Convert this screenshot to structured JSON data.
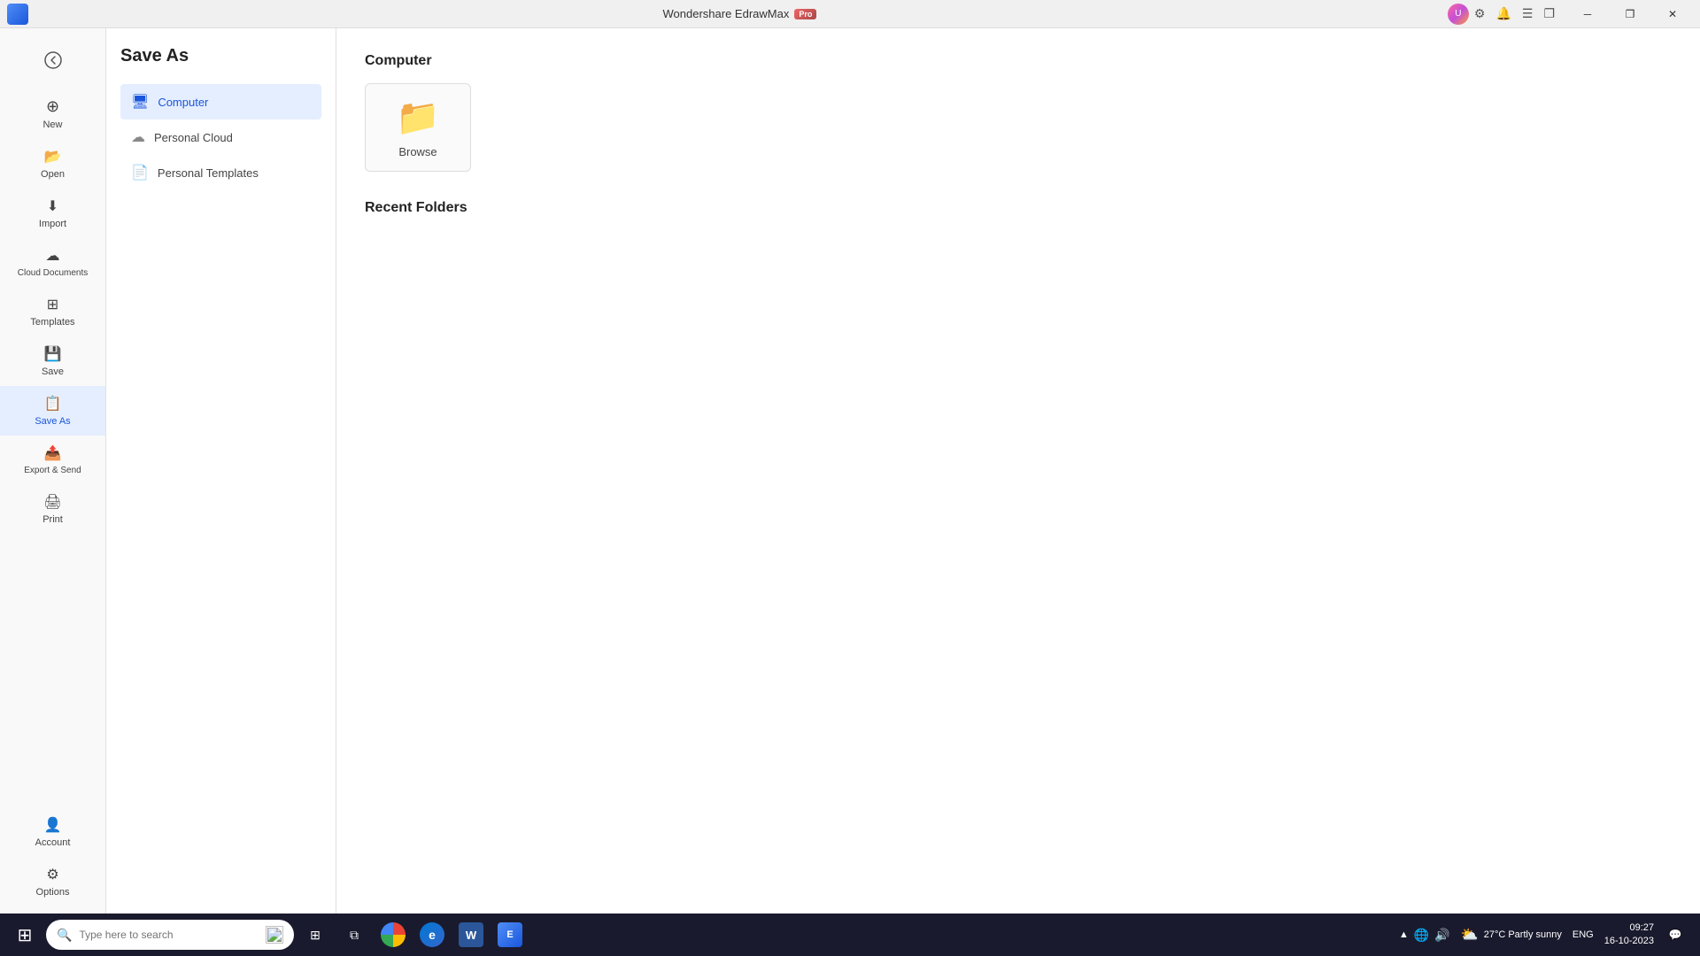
{
  "titlebar": {
    "app_name": "Wondershare EdrawMax",
    "pro_label": "Pro",
    "minimize_label": "─",
    "restore_label": "❐",
    "close_label": "✕"
  },
  "sidebar": {
    "back_label": "←",
    "items": [
      {
        "id": "new",
        "label": "New",
        "icon": "⊕"
      },
      {
        "id": "open",
        "label": "Open",
        "icon": "📂"
      },
      {
        "id": "import",
        "label": "Import",
        "icon": "⬇"
      },
      {
        "id": "cloud",
        "label": "Cloud Documents",
        "icon": "☁"
      },
      {
        "id": "templates",
        "label": "Templates",
        "icon": "⊞"
      },
      {
        "id": "save",
        "label": "Save",
        "icon": "💾"
      },
      {
        "id": "saveas",
        "label": "Save As",
        "icon": "📋",
        "active": true
      },
      {
        "id": "export",
        "label": "Export & Send",
        "icon": "📤"
      },
      {
        "id": "print",
        "label": "Print",
        "icon": "🖨"
      }
    ],
    "bottom_items": [
      {
        "id": "account",
        "label": "Account",
        "icon": "👤"
      },
      {
        "id": "options",
        "label": "Options",
        "icon": "⚙"
      }
    ]
  },
  "save_as_panel": {
    "title": "Save As",
    "options": [
      {
        "id": "computer",
        "label": "Computer",
        "icon": "🖥",
        "active": true
      },
      {
        "id": "personal_cloud",
        "label": "Personal Cloud",
        "icon": "☁"
      },
      {
        "id": "personal_templates",
        "label": "Personal Templates",
        "icon": "📄"
      }
    ]
  },
  "main": {
    "computer_title": "Computer",
    "browse_label": "Browse",
    "recent_folders_title": "Recent Folders"
  },
  "taskbar": {
    "start_icon": "⊞",
    "search_placeholder": "Type here to search",
    "search_icon": "🔍",
    "widget_icon": "⊞",
    "apps": [
      {
        "id": "chrome",
        "label": "Chrome",
        "color": "#4285f4"
      },
      {
        "id": "edge",
        "label": "Edge",
        "color": "#0078d4"
      },
      {
        "id": "word",
        "label": "Word",
        "color": "#2b579a"
      },
      {
        "id": "edraw",
        "label": "EdrawMax",
        "color": "#2563eb"
      }
    ],
    "system": {
      "weather": "27°C  Partly sunny",
      "lang": "ENG",
      "time": "09:27",
      "date": "16-10-2023"
    }
  }
}
